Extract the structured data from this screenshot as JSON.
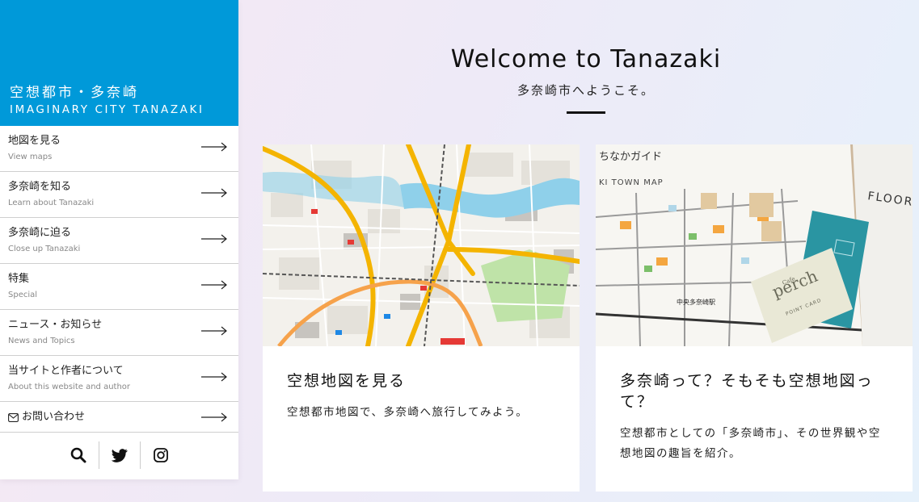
{
  "brand": {
    "title_jp": "空想都市・多奈崎",
    "title_en": "IMAGINARY CITY TANAZAKI"
  },
  "nav": [
    {
      "label": "地図を見る",
      "sub": "View maps"
    },
    {
      "label": "多奈崎を知る",
      "sub": "Learn about Tanazaki"
    },
    {
      "label": "多奈崎に迫る",
      "sub": "Close up Tanazaki"
    },
    {
      "label": "特集",
      "sub": "Special"
    },
    {
      "label": "ニュース・お知らせ",
      "sub": "News and Topics"
    },
    {
      "label": "当サイトと作者について",
      "sub": "About this website and author"
    }
  ],
  "contact": {
    "label": "お問い合わせ"
  },
  "social": [
    "search-icon",
    "twitter-icon",
    "instagram-icon"
  ],
  "hero": {
    "title": "Welcome to Tanazaki",
    "subtitle": "多奈崎市へようこそ。"
  },
  "cards": [
    {
      "title": "空想地図を見る",
      "desc": "空想都市地図で、多奈崎へ旅行してみよう。"
    },
    {
      "title": "多奈崎って？そもそも空想地図って？",
      "desc": "空想都市としての「多奈崎市」、その世界観や空想地図の趣旨を紹介。"
    }
  ],
  "guide_image": {
    "header": "ちなかガイド",
    "map_title": "KI TOWN MAP",
    "floor": "FLOOR",
    "card_name": "perch",
    "card_small": "Cafe",
    "card_sub": "POINT CARD",
    "station": "中央多奈崎駅"
  },
  "colors": {
    "brand": "#0099d9",
    "rail": "#f4b400",
    "river": "#8fd0ea"
  }
}
